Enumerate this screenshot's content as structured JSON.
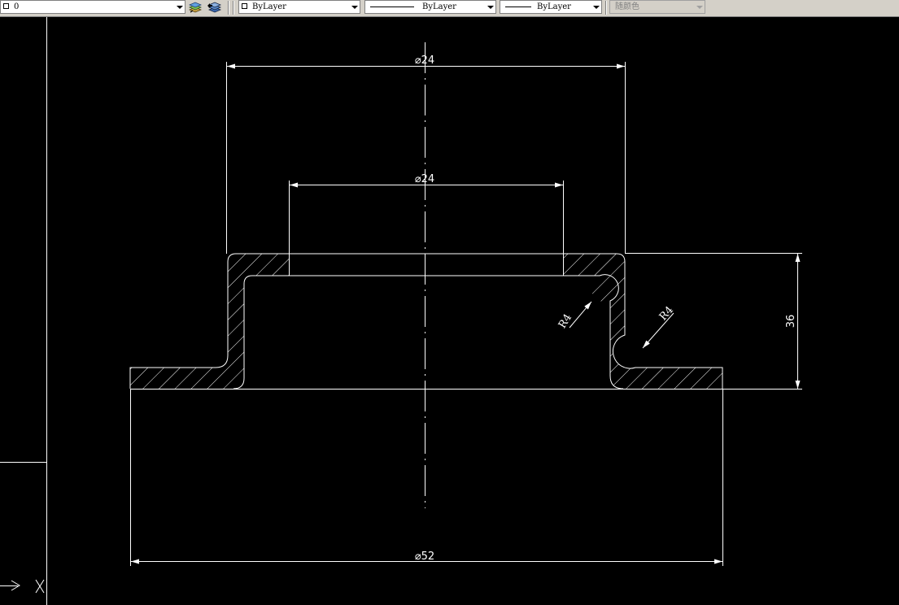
{
  "toolbar": {
    "layer": "0",
    "color": "ByLayer",
    "linetype": "ByLayer",
    "lineweight": "ByLayer",
    "plotstyle": "随颜色"
  },
  "colors": {
    "canvas_bg": "#000000",
    "geometry": "#ffffff",
    "toolbar_bg": "#d4d0c8",
    "disabled_text": "#808080"
  },
  "icons": {
    "layer_state": "layer-stack-icon",
    "layer_previous": "layer-previous-icon",
    "ucs": "ucs-icon"
  },
  "drawing": {
    "dim_top": "⌀24",
    "dim_mid": "⌀24",
    "dim_bottom": "⌀52",
    "dim_height": "36",
    "radius_left": "R4",
    "radius_right": "R4"
  }
}
